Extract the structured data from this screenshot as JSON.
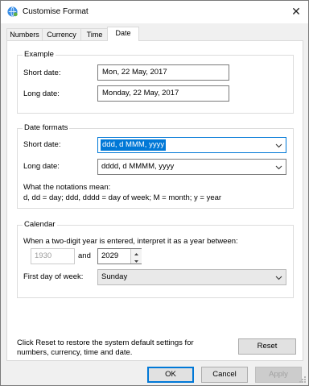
{
  "window": {
    "title": "Customise Format",
    "close_glyph": "✕"
  },
  "tabs": [
    {
      "label": "Numbers"
    },
    {
      "label": "Currency"
    },
    {
      "label": "Time"
    },
    {
      "label": "Date"
    }
  ],
  "active_tab": "Date",
  "example": {
    "title": "Example",
    "short_label": "Short date:",
    "short_value": "Mon, 22 May, 2017",
    "long_label": "Long date:",
    "long_value": "Monday, 22 May, 2017"
  },
  "formats": {
    "title": "Date formats",
    "short_label": "Short date:",
    "short_value": "ddd, d MMM, yyyy",
    "long_label": "Long date:",
    "long_value": "dddd, d MMMM, yyyy",
    "notations_heading": "What the notations mean:",
    "notations_text": "d, dd = day;  ddd, dddd = day of week;  M = month;  y = year"
  },
  "calendar": {
    "title": "Calendar",
    "two_digit_text": "When a two-digit year is entered, interpret it as a year between:",
    "from_year": "1930",
    "and_label": "and",
    "to_year": "2029",
    "first_day_label": "First day of week:",
    "first_day_value": "Sunday"
  },
  "footer": {
    "reset_hint": "Click Reset to restore the system default settings for numbers, currency, time and date.",
    "reset_label": "Reset"
  },
  "buttons": {
    "ok": "OK",
    "cancel": "Cancel",
    "apply": "Apply"
  },
  "colors": {
    "accent": "#0078d7",
    "panel_bg": "#ffffff",
    "window_bg": "#f0f0f0"
  }
}
